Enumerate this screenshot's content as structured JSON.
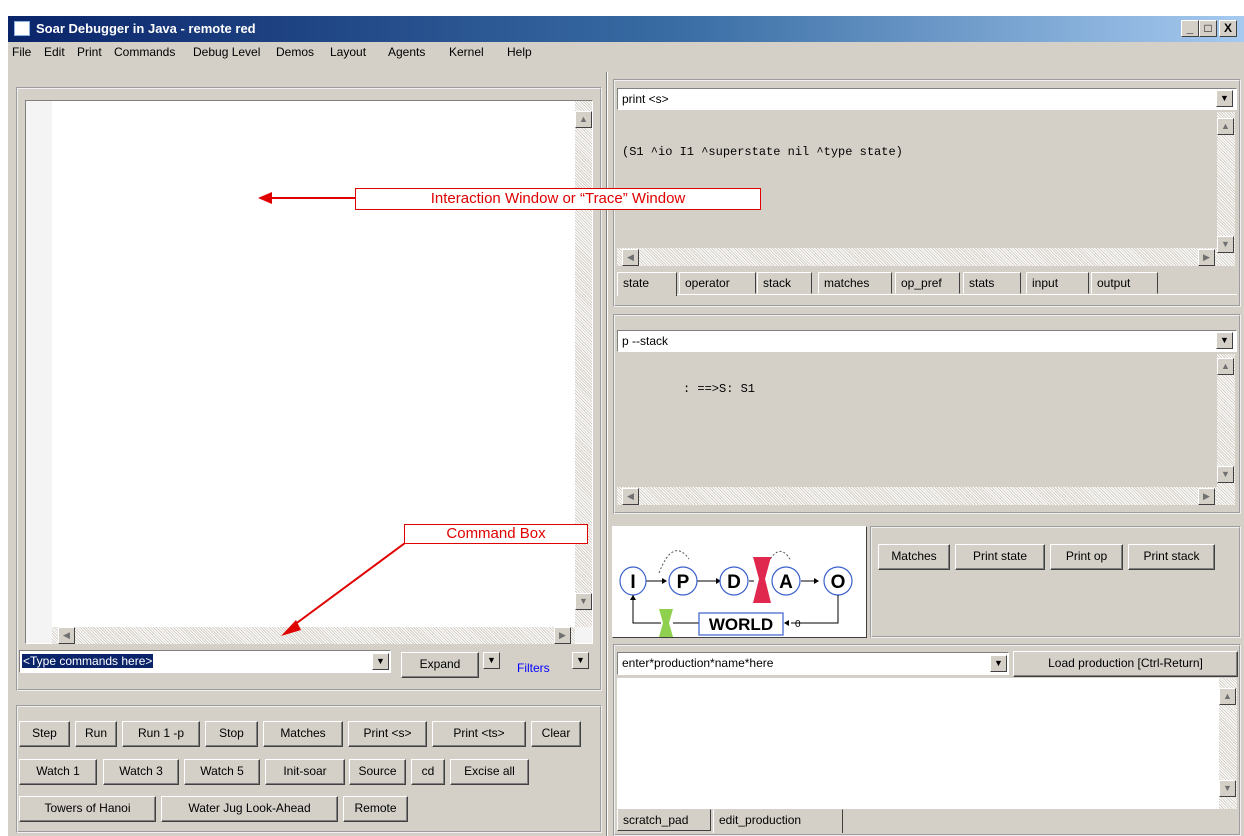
{
  "window": {
    "title": "Soar Debugger in Java - remote red",
    "controls": {
      "minimize": "_",
      "maximize": "□",
      "close": "X"
    }
  },
  "menu": [
    "File",
    "Edit",
    "Print",
    "Commands",
    "Debug Level",
    "Demos",
    "Layout",
    "Agents",
    "Kernel",
    "Help"
  ],
  "trace": {
    "annotation": "Interaction Window or “Trace” Window"
  },
  "command_box": {
    "value": "<Type commands here>",
    "annotation": "Command Box",
    "expand_label": "Expand",
    "filters_label": "Filters"
  },
  "buttons": {
    "row1": [
      "Step",
      "Run",
      "Run 1 -p",
      "Stop",
      "Matches",
      "Print <s>",
      "Print <ts>",
      "Clear"
    ],
    "row2": [
      "Watch 1",
      "Watch 3",
      "Watch 5",
      "Init-soar",
      "Source",
      "cd",
      "Excise all"
    ],
    "row3": [
      "Towers of Hanoi",
      "Water Jug Look-Ahead",
      "Remote"
    ]
  },
  "state_view": {
    "combo_value": "print <s>",
    "output": "(S1 ^io I1 ^superstate nil ^type state)",
    "tabs": [
      "state",
      "operator",
      "stack",
      "matches",
      "op_pref",
      "stats",
      "input",
      "output"
    ],
    "selected_tab": "state"
  },
  "stack_view": {
    "combo_value": "p --stack",
    "output": ": ==>S: S1"
  },
  "phase_diagram": {
    "phases": [
      "I",
      "P",
      "D",
      "A",
      "O"
    ],
    "world_label": "WORLD",
    "world_count": "0",
    "colors": {
      "phase_ring": "#3a5fcd",
      "stop_marker": "#e0284f",
      "input_marker": "#8fd14f"
    }
  },
  "quick_buttons": [
    "Matches",
    "Print state",
    "Print op",
    "Print stack"
  ],
  "edit_production": {
    "combo_value": "enter*production*name*here",
    "load_label": "Load production [Ctrl-Return]",
    "tabs": [
      "scratch_pad",
      "edit_production"
    ],
    "selected_tab": "edit_production"
  },
  "colors": {
    "annotation": "#e00000",
    "filters_link": "#0000ff",
    "selection": "#0a246a"
  }
}
